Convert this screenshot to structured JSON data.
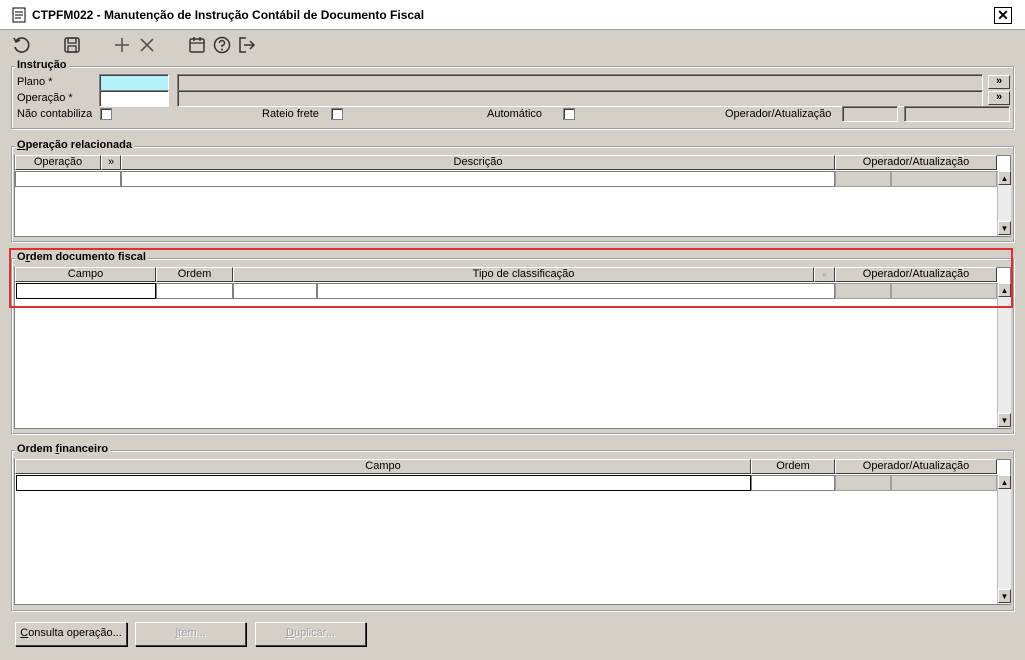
{
  "window": {
    "title": "CTPFM022 - Manutenção de Instrução Contábil de Documento Fiscal",
    "close_glyph": "✕"
  },
  "toolbar": {
    "icons": [
      "undo-icon",
      "save-icon",
      "add-icon",
      "delete-icon",
      "calendar-icon",
      "help-icon",
      "exit-icon"
    ]
  },
  "instrucao": {
    "label": "Instrução",
    "plano_label": "Plano *",
    "plano_value": "",
    "operacao_label": "Operação *",
    "operacao_value": "",
    "nao_contabiliza_label": "Não contabiliza",
    "rateio_frete_label": "Rateio frete",
    "automatico_label": "Automático",
    "operador_label": "Operador/Atualização",
    "ellipsis": "»"
  },
  "operacao_relacionada": {
    "label_u": "O",
    "label_rest": "peração relacionada",
    "columns": [
      "Operação",
      "»",
      "Descrição",
      "Operador/Atualização"
    ]
  },
  "ordem_documento_fiscal": {
    "label_pre": "O",
    "label_u": "r",
    "label_rest": "dem documento fiscal",
    "columns": [
      "Campo",
      "Ordem",
      "Tipo de classificação",
      "Operador/Atualização"
    ]
  },
  "ordem_financeiro": {
    "label_pre": "Ordem ",
    "label_u": "f",
    "label_rest": "inanceiro",
    "columns": [
      "Campo",
      "Ordem",
      "Operador/Atualização"
    ]
  },
  "scroll": {
    "up": "▲",
    "down": "▼"
  },
  "buttons": {
    "consulta_u": "C",
    "consulta_rest": "onsulta operação...",
    "item_u": "I",
    "item_rest": "tem...",
    "duplicar_u": "D",
    "duplicar_rest": "uplicar..."
  },
  "colors": {
    "window_bg": "#d4d0c8",
    "highlight": "#e03030",
    "required_field": "#b4f0fa"
  }
}
